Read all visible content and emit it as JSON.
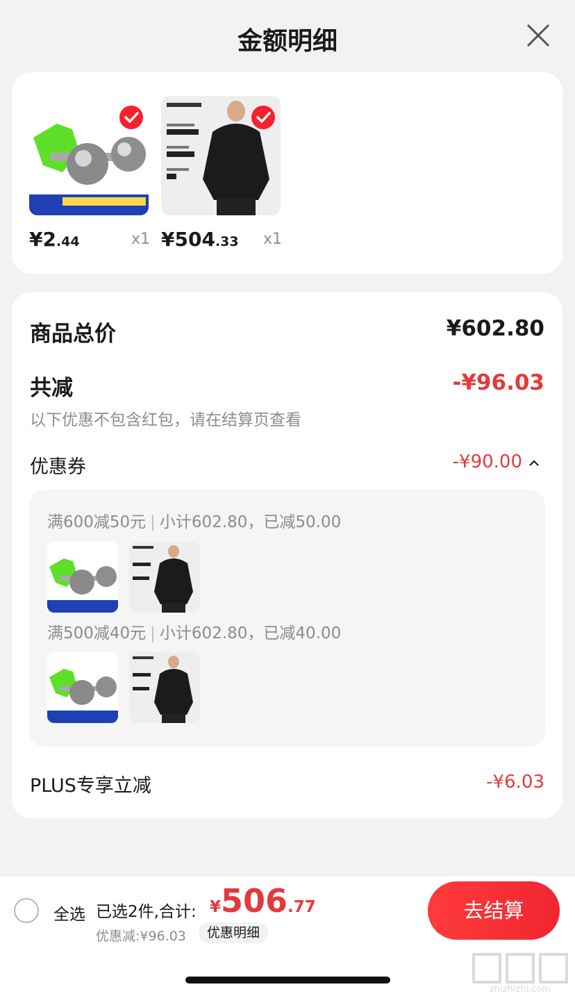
{
  "header": {
    "title": "金额明细",
    "close_icon": "close-icon"
  },
  "products": [
    {
      "price_int": "¥2",
      "price_dec": ".44",
      "qty": "x1",
      "checked": true,
      "image": "fishing-bell"
    },
    {
      "price_int": "¥504",
      "price_dec": ".33",
      "qty": "x1",
      "checked": true,
      "image": "black-jacket"
    }
  ],
  "summary": {
    "total_label": "商品总价",
    "total_value": "¥602.80",
    "reduce_label": "共减",
    "reduce_value": "-¥96.03",
    "note": "以下优惠不包含红包，请在结算页查看",
    "coupon_label": "优惠券",
    "coupon_value": "-¥90.00",
    "coupon_rules": [
      {
        "rule": "满600减50元",
        "detail": "小计602.80，已减50.00"
      },
      {
        "rule": "满500减40元",
        "detail": "小计602.80，已减40.00"
      }
    ],
    "plus_label": "PLUS专享立减",
    "plus_value": "-¥6.03"
  },
  "bottom": {
    "select_all": "全选",
    "selected_text": "已选2件,合计:",
    "sum_currency": "¥",
    "sum_int": "506",
    "sum_dec": ".77",
    "discount_text": "优惠减:¥96.03",
    "detail_link": "优惠明细",
    "checkout": "去结算"
  },
  "colors": {
    "accent": "#e4393c",
    "checkout": "#f0262f",
    "background": "#f2f2f2"
  }
}
